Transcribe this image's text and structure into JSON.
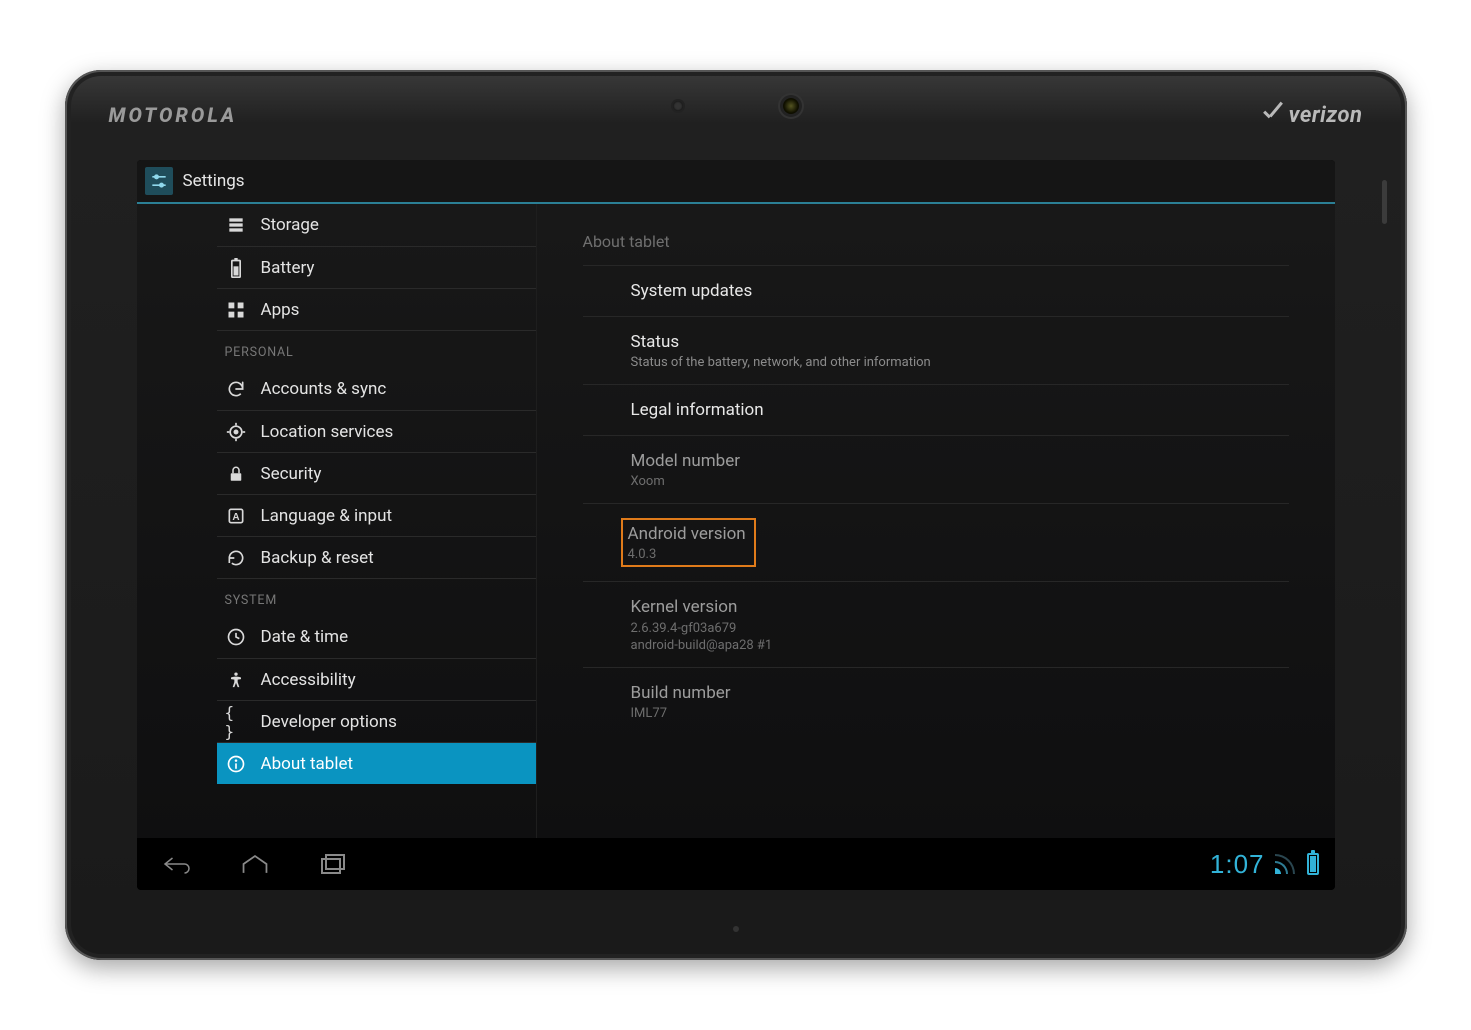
{
  "device": {
    "brand_left": "MOTOROLA",
    "brand_right": "verizon"
  },
  "app": {
    "title": "Settings"
  },
  "sidebar": {
    "items": [
      {
        "icon": "storage-icon",
        "label": "Storage"
      },
      {
        "icon": "battery-icon",
        "label": "Battery"
      },
      {
        "icon": "apps-icon",
        "label": "Apps"
      }
    ],
    "personal_header": "PERSONAL",
    "personal": [
      {
        "icon": "sync-icon",
        "label": "Accounts & sync"
      },
      {
        "icon": "location-icon",
        "label": "Location services"
      },
      {
        "icon": "security-icon",
        "label": "Security"
      },
      {
        "icon": "language-icon",
        "label": "Language & input"
      },
      {
        "icon": "backup-icon",
        "label": "Backup & reset"
      }
    ],
    "system_header": "SYSTEM",
    "system": [
      {
        "icon": "clock-icon",
        "label": "Date & time"
      },
      {
        "icon": "accessibility-icon",
        "label": "Accessibility"
      },
      {
        "icon": "developer-icon",
        "label": "Developer options"
      },
      {
        "icon": "about-icon",
        "label": "About tablet",
        "selected": true
      }
    ]
  },
  "content": {
    "header": "About tablet",
    "system_updates": "System updates",
    "status_title": "Status",
    "status_sub": "Status of the battery, network, and other information",
    "legal": "Legal information",
    "model_title": "Model number",
    "model_value": "Xoom",
    "android_title": "Android version",
    "android_value": "4.0.3",
    "kernel_title": "Kernel version",
    "kernel_value1": "2.6.39.4-gf03a679",
    "kernel_value2": "android-build@apa28 #1",
    "build_title": "Build number",
    "build_value": "IML77"
  },
  "statusbar": {
    "time": "1:07"
  }
}
